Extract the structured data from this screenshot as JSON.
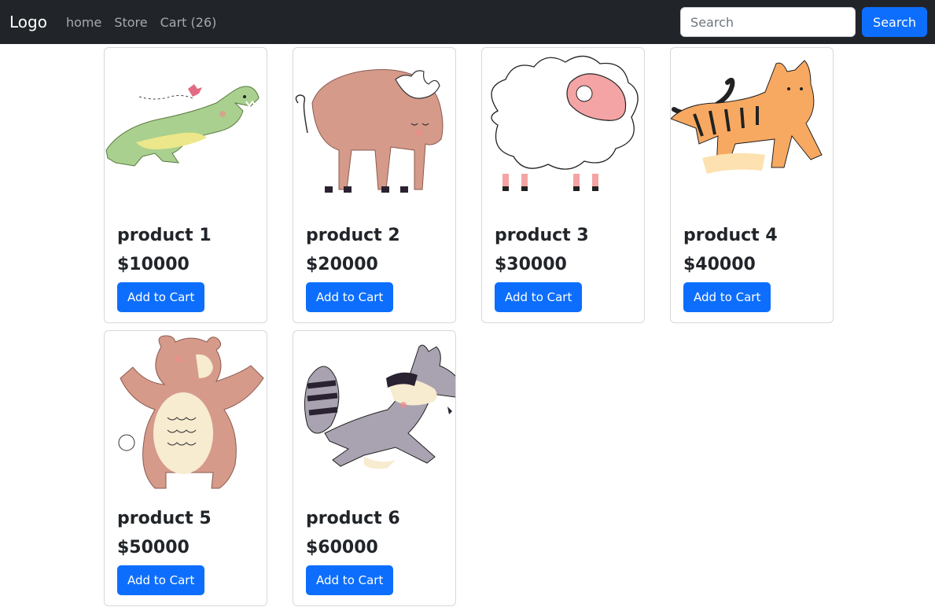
{
  "navbar": {
    "brand": "Logo",
    "links": [
      "home",
      "Store",
      "Cart (26)"
    ],
    "search_placeholder": "Search",
    "search_button": "Search"
  },
  "products": [
    {
      "title": "product 1",
      "price": "$10000",
      "button": "Add to Cart",
      "image": "crocodile"
    },
    {
      "title": "product 2",
      "price": "$20000",
      "button": "Add to Cart",
      "image": "bison"
    },
    {
      "title": "product 3",
      "price": "$30000",
      "button": "Add to Cart",
      "image": "sheep"
    },
    {
      "title": "product 4",
      "price": "$40000",
      "button": "Add to Cart",
      "image": "tiger"
    },
    {
      "title": "product 5",
      "price": "$50000",
      "button": "Add to Cart",
      "image": "bear"
    },
    {
      "title": "product 6",
      "price": "$60000",
      "button": "Add to Cart",
      "image": "raccoon"
    }
  ],
  "colors": {
    "navbar_bg": "#212529",
    "primary": "#0d6efd"
  }
}
